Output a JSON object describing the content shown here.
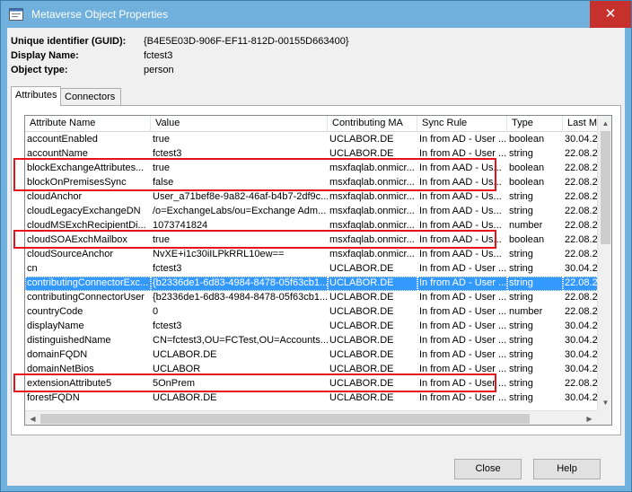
{
  "window": {
    "title": "Metaverse Object Properties",
    "close_glyph": "✕"
  },
  "info": {
    "guid_label": "Unique identifier (GUID):",
    "guid_value": "{B4E5E03D-906F-EF11-812D-00155D663400}",
    "display_name_label": "Display Name:",
    "display_name_value": "fctest3",
    "object_type_label": "Object type:",
    "object_type_value": "person"
  },
  "tabs": [
    {
      "label": "Attributes",
      "active": true
    },
    {
      "label": "Connectors",
      "active": false
    }
  ],
  "grid": {
    "columns": [
      "Attribute Name",
      "Value",
      "Contributing MA",
      "Sync Rule",
      "Type",
      "Last Mo"
    ],
    "rows": [
      [
        "accountEnabled",
        "true",
        "UCLABOR.DE",
        "In from AD - User ...",
        "boolean",
        "30.04.2"
      ],
      [
        "accountName",
        "fctest3",
        "UCLABOR.DE",
        "In from AD - User ...",
        "string",
        "22.08.2"
      ],
      [
        "blockExchangeAttributes...",
        "true",
        "msxfaqlab.onmicr...",
        "In from AAD - Us...",
        "boolean",
        "22.08.2"
      ],
      [
        "blockOnPremisesSync",
        "false",
        "msxfaqlab.onmicr...",
        "In from AAD - Us...",
        "boolean",
        "22.08.2"
      ],
      [
        "cloudAnchor",
        "User_a71bef8e-9a82-46af-b4b7-2df9c...",
        "msxfaqlab.onmicr...",
        "In from AAD - Us...",
        "string",
        "22.08.2"
      ],
      [
        "cloudLegacyExchangeDN",
        "/o=ExchangeLabs/ou=Exchange Adm...",
        "msxfaqlab.onmicr...",
        "In from AAD - Us...",
        "string",
        "22.08.2"
      ],
      [
        "cloudMSExchRecipientDi...",
        "1073741824",
        "msxfaqlab.onmicr...",
        "In from AAD - Us...",
        "number",
        "22.08.2"
      ],
      [
        "cloudSOAExchMailbox",
        "true",
        "msxfaqlab.onmicr...",
        "In from AAD - Us...",
        "boolean",
        "22.08.2"
      ],
      [
        "cloudSourceAnchor",
        "NvXE+i1c30iILPkRRL10ew==",
        "msxfaqlab.onmicr...",
        "In from AAD - Us...",
        "string",
        "22.08.2"
      ],
      [
        "cn",
        "fctest3",
        "UCLABOR.DE",
        "In from AD - User ...",
        "string",
        "30.04.2"
      ],
      [
        "contributingConnectorExc...",
        "{b2336de1-6d83-4984-8478-05f63cb1...",
        "UCLABOR.DE",
        "In from AD - User ...",
        "string",
        "22.08.2"
      ],
      [
        "contributingConnectorUser",
        "{b2336de1-6d83-4984-8478-05f63cb1...",
        "UCLABOR.DE",
        "In from AD - User ...",
        "string",
        "22.08.2"
      ],
      [
        "countryCode",
        "0",
        "UCLABOR.DE",
        "In from AD - User ...",
        "number",
        "22.08.2"
      ],
      [
        "displayName",
        "fctest3",
        "UCLABOR.DE",
        "In from AD - User ...",
        "string",
        "30.04.2"
      ],
      [
        "distinguishedName",
        "CN=fctest3,OU=FCTest,OU=Accounts...",
        "UCLABOR.DE",
        "In from AD - User ...",
        "string",
        "30.04.2"
      ],
      [
        "domainFQDN",
        "UCLABOR.DE",
        "UCLABOR.DE",
        "In from AD - User ...",
        "string",
        "30.04.2"
      ],
      [
        "domainNetBios",
        "UCLABOR",
        "UCLABOR.DE",
        "In from AD - User ...",
        "string",
        "30.04.2"
      ],
      [
        "extensionAttribute5",
        "5OnPrem",
        "UCLABOR.DE",
        "In from AD - User ...",
        "string",
        "22.08.2"
      ],
      [
        "forestFQDN",
        "UCLABOR.DE",
        "UCLABOR.DE",
        "In from AD - User ...",
        "string",
        "30.04.2"
      ]
    ],
    "selected_row": 10,
    "highlighted_rows": [
      2,
      3,
      7,
      17
    ]
  },
  "buttons": {
    "close": "Close",
    "help": "Help"
  }
}
